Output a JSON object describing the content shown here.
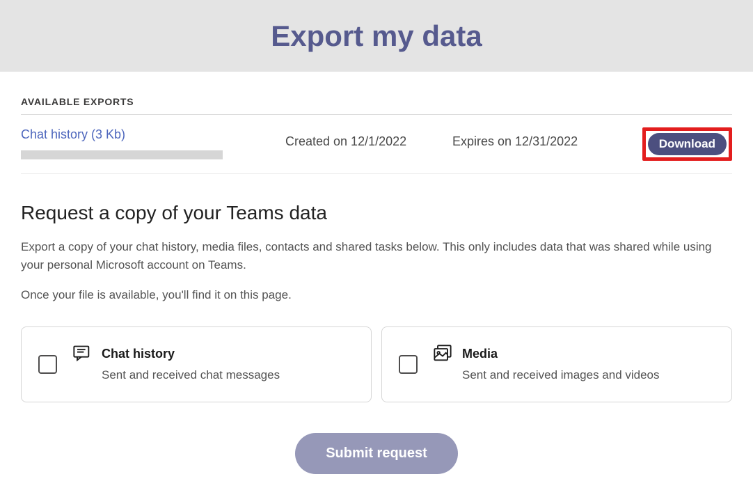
{
  "header": {
    "title": "Export my data"
  },
  "exports": {
    "section_label": "AVAILABLE EXPORTS",
    "items": [
      {
        "name": "Chat history (3 Kb)",
        "created_label": "Created on 12/1/2022",
        "expires_label": "Expires on 12/31/2022",
        "download_label": "Download"
      }
    ]
  },
  "request": {
    "heading": "Request a copy of your Teams data",
    "description_line1": "Export a copy of your chat history, media files, contacts and shared tasks below. This only includes data that was shared while using your personal Microsoft account on Teams.",
    "description_line2": "Once your file is available, you'll find it on this page.",
    "options": [
      {
        "title": "Chat history",
        "subtitle": "Sent and received chat messages"
      },
      {
        "title": "Media",
        "subtitle": "Sent and received images and videos"
      }
    ],
    "submit_label": "Submit request"
  }
}
